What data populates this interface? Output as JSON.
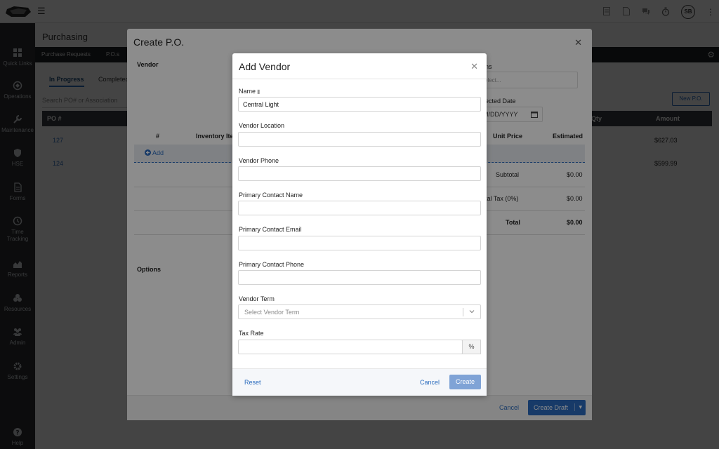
{
  "header": {
    "avatar_initials": "SB"
  },
  "sidebar": {
    "items": [
      {
        "label": "Quick Links",
        "icon": "grid-icon"
      },
      {
        "label": "Operations",
        "icon": "operations-icon"
      },
      {
        "label": "Maintenance",
        "icon": "wrench-icon"
      },
      {
        "label": "HSE",
        "icon": "shield-icon"
      },
      {
        "label": "Forms",
        "icon": "document-icon"
      },
      {
        "label": "Time Tracking",
        "icon": "clock-icon"
      },
      {
        "label": "Reports",
        "icon": "chart-icon"
      },
      {
        "label": "Resources",
        "icon": "resources-icon"
      },
      {
        "label": "Admin",
        "icon": "users-icon"
      },
      {
        "label": "Settings",
        "icon": "gear-icon"
      },
      {
        "label": "Help",
        "icon": "help-icon"
      }
    ]
  },
  "main": {
    "title": "Purchasing",
    "subnav": [
      "Purchase Requests",
      "P.O.s"
    ],
    "tabs": [
      "In Progress",
      "Completed"
    ],
    "search_placeholder": "Search PO# or Association",
    "new_button": "New P.O.",
    "table_headers": {
      "po": "PO #",
      "qty": "Qty",
      "amount": "Amount"
    },
    "rows": [
      {
        "po": "127",
        "amount": "$627.03"
      },
      {
        "po": "124",
        "amount": "$599.99"
      }
    ]
  },
  "po_modal": {
    "title": "Create P.O.",
    "vendor_label": "Vendor",
    "associations_label": "ns",
    "associations_placeholder": "elect...",
    "expected_date_label": "ected Date",
    "date_placeholder": "M/DD/YYYY",
    "items_headers": {
      "num": "#",
      "item": "Inventory Ite",
      "unit_price": "Unit Price",
      "estimated": "Estimated"
    },
    "add_label": "Add",
    "subtotal_label": "Subtotal",
    "subtotal_value": "$0.00",
    "tax_label": "tal Tax (0%)",
    "tax_value": "$0.00",
    "total_label": "Total",
    "total_value": "$0.00",
    "options_label": "Options",
    "cancel_label": "Cancel",
    "draft_label": "Create Draft"
  },
  "add_vendor": {
    "title": "Add Vendor",
    "fields": {
      "name": {
        "label": "Name",
        "value": "Central Light"
      },
      "location": {
        "label": "Vendor Location",
        "value": ""
      },
      "phone": {
        "label": "Vendor Phone",
        "value": ""
      },
      "contact_name": {
        "label": "Primary Contact Name",
        "value": ""
      },
      "contact_email": {
        "label": "Primary Contact Email",
        "value": ""
      },
      "contact_phone": {
        "label": "Primary Contact Phone",
        "value": ""
      },
      "term": {
        "label": "Vendor Term",
        "placeholder": "Select Vendor Term"
      },
      "tax_rate": {
        "label": "Tax Rate",
        "value": "",
        "suffix": "%"
      }
    },
    "reset_label": "Reset",
    "cancel_label": "Cancel",
    "create_label": "Create"
  }
}
